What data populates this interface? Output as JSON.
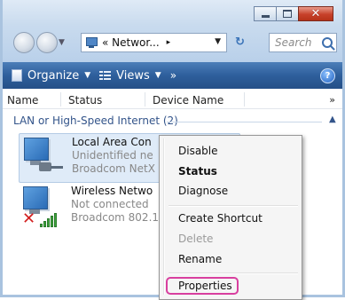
{
  "window": {
    "caption": {
      "minimize_icon": "minimize-icon",
      "maximize_icon": "maximize-icon",
      "close_glyph": "✕"
    }
  },
  "nav": {
    "address_text": "« Networ...",
    "chevron": "▸",
    "search_placeholder": "Search",
    "refresh_glyph": "↻"
  },
  "toolbar": {
    "organize_label": "Organize",
    "views_label": "Views",
    "more_label": "»",
    "help_label": "?"
  },
  "columns": {
    "name": "Name",
    "status": "Status",
    "device_name": "Device Name",
    "more": "»"
  },
  "group": {
    "label": "LAN or High-Speed Internet (2)",
    "collapse_glyph": "▲"
  },
  "connections": [
    {
      "name": "Local Area Con",
      "status": "Unidentified ne",
      "device": "Broadcom NetX"
    },
    {
      "name": "Wireless Netwo",
      "status": "Not connected",
      "device": "Broadcom 802.1"
    }
  ],
  "context_menu": {
    "items": [
      "Disable",
      "Status",
      "Diagnose",
      "Create Shortcut",
      "Delete",
      "Rename",
      "Properties"
    ],
    "default_item": "Status",
    "disabled_item": "Delete",
    "highlighted_item": "Properties"
  },
  "colors": {
    "command_bar": "#2e5f9c",
    "highlight_outline": "#d83f9f",
    "group_text": "#33548a"
  }
}
